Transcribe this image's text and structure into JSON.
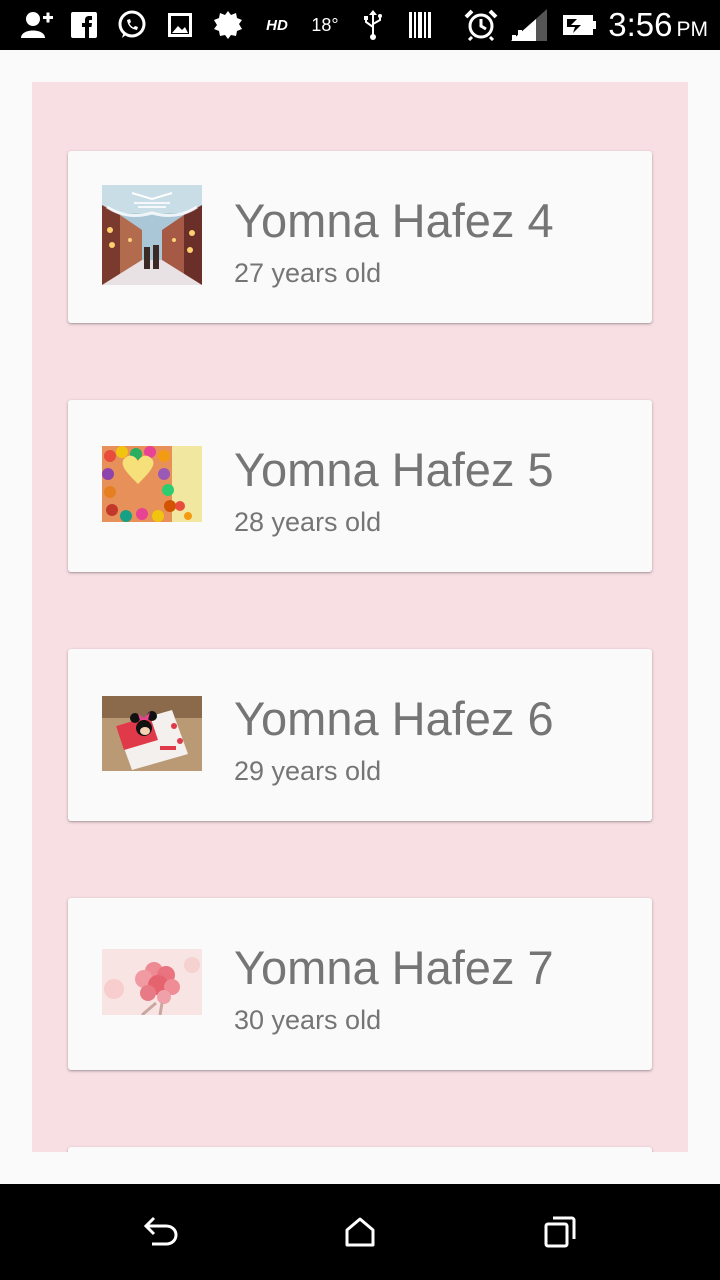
{
  "status_bar": {
    "time": "3:56",
    "ampm": "PM",
    "hd": "HD",
    "temperature": "18°",
    "icons": [
      "add-contact-icon",
      "facebook-icon",
      "whatsapp-icon",
      "gallery-icon",
      "settings-cog-icon",
      "hd-icon",
      "temperature-icon",
      "usb-icon",
      "barcode-icon",
      "alarm-icon",
      "signal-icon",
      "battery-icon"
    ]
  },
  "list": {
    "items": [
      {
        "name": "Yomna Hafez 4",
        "age": "27 years old",
        "thumbnail": "winter-street-photo"
      },
      {
        "name": "Yomna Hafez 5",
        "age": "28 years old",
        "thumbnail": "candy-heart-photo"
      },
      {
        "name": "Yomna Hafez 6",
        "age": "29 years old",
        "thumbnail": "minnie-card-photo"
      },
      {
        "name": "Yomna Hafez 7",
        "age": "30 years old",
        "thumbnail": "pink-roses-photo"
      }
    ]
  },
  "colors": {
    "list_background": "#f7dfe4",
    "card_background": "#fafafa",
    "text": "#757575"
  },
  "nav_bar": {
    "icons": [
      "back-icon",
      "home-icon",
      "recent-apps-icon"
    ]
  }
}
